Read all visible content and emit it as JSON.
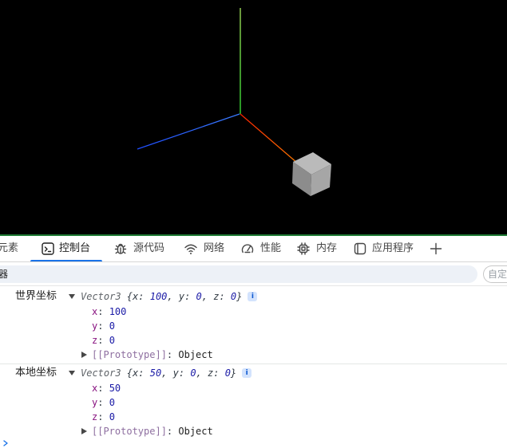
{
  "scene": {
    "background": "#000000",
    "border_color": "#1e7b34",
    "axis_x_color": "#ff2200",
    "axis_x_end_color": "#ff7a00",
    "axis_y_color": "#3cff3c",
    "axis_y_end_color": "#b8ff66",
    "axis_z_color": "#3a7bff",
    "axis_z_end_color": "#1f4dff"
  },
  "devtools": {
    "accent_color": "#1a73e8",
    "tabs": [
      {
        "label": "元素",
        "icon": null,
        "active": false
      },
      {
        "label": "控制台",
        "icon": "console-icon",
        "active": true
      },
      {
        "label": "源代码",
        "icon": "bug-icon",
        "active": false
      },
      {
        "label": "网络",
        "icon": "wifi-icon",
        "active": false
      },
      {
        "label": "性能",
        "icon": "gauge-icon",
        "active": false
      },
      {
        "label": "内存",
        "icon": "memory-chip-icon",
        "active": false
      },
      {
        "label": "应用程序",
        "icon": "application-icon",
        "active": false
      }
    ],
    "add_tab_icon": "plus-icon"
  },
  "console_toolbar": {
    "filter_text": "器",
    "levels_button_label": "自定"
  },
  "console": {
    "entries": [
      {
        "label": "世界坐标",
        "class_name": "Vector3",
        "expanded": true,
        "info_badge": "i",
        "properties": [
          {
            "key": "x",
            "value": 100
          },
          {
            "key": "y",
            "value": 0
          },
          {
            "key": "z",
            "value": 0
          }
        ],
        "prototype_key": "[[Prototype]]",
        "prototype_value": "Object"
      },
      {
        "label": "本地坐标",
        "class_name": "Vector3",
        "expanded": true,
        "info_badge": "i",
        "properties": [
          {
            "key": "x",
            "value": 50
          },
          {
            "key": "y",
            "value": 0
          },
          {
            "key": "z",
            "value": 0
          }
        ],
        "prototype_key": "[[Prototype]]",
        "prototype_value": "Object"
      }
    ],
    "prompt_icon": "chevron-right-icon"
  }
}
